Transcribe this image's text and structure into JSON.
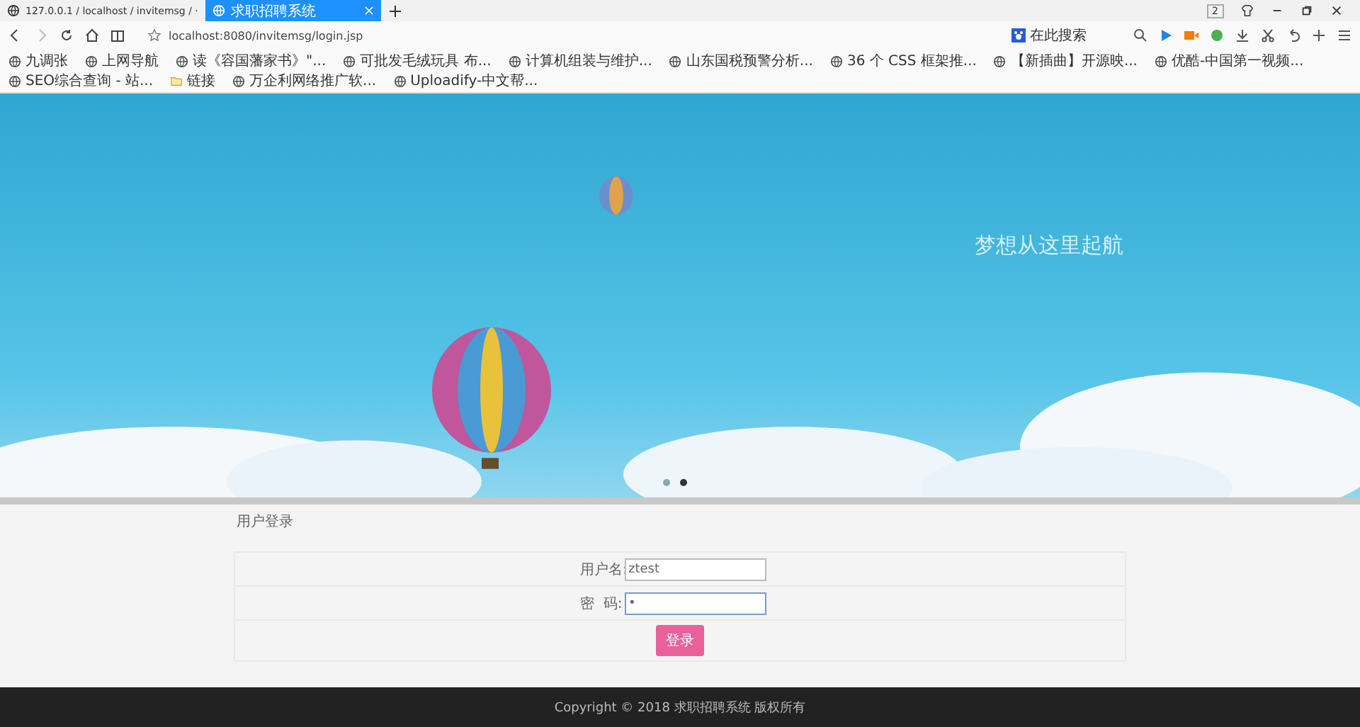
{
  "browser": {
    "tabs": [
      {
        "title": "127.0.0.1 / localhost / invitemsg / ·",
        "selected": false
      },
      {
        "title": "求职招聘系统",
        "selected": true
      }
    ],
    "tab_count": "2",
    "address": "localhost:8080/invitemsg/login.jsp",
    "search": {
      "placeholder": "在此搜索"
    },
    "bookmarks": [
      "九调张",
      "上网导航",
      "读《容国藩家书》\"...",
      "可批发毛绒玩具 布...",
      "计算机组装与维护...",
      "山东国税预警分析...",
      "36 个 CSS 框架推...",
      "【新插曲】开源映...",
      "优酷-中国第一视频...",
      "SEO综合查询 - 站...",
      "链接",
      "万企利网络推广软...",
      "Uploadify-中文帮..."
    ]
  },
  "banner": {
    "slogan": "梦想从这里起航",
    "dots": [
      {
        "selected": false
      },
      {
        "selected": true
      }
    ]
  },
  "login": {
    "title": "用户登录",
    "fields": [
      {
        "label": "用户名:",
        "value": "ztest",
        "kind": "text"
      },
      {
        "label": "密  码:",
        "value": "•",
        "kind": "password"
      }
    ],
    "button": "登录"
  },
  "footer": "Copyright © 2018 求职招聘系统 版权所有"
}
